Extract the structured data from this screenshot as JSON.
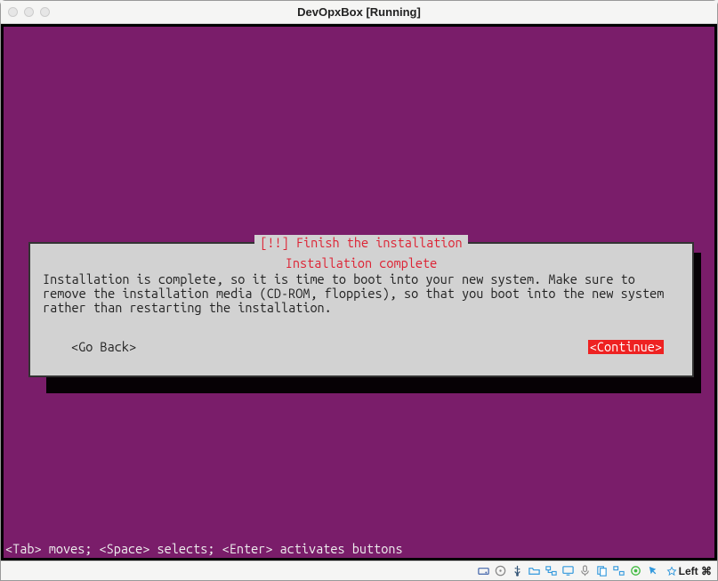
{
  "window": {
    "title_app": "DevOpxBox",
    "title_state": "[Running]"
  },
  "dialog": {
    "title": "[!!] Finish the installation",
    "subtitle": "Installation complete",
    "body": "Installation is complete, so it is time to boot into your new system. Make sure to remove the installation media (CD-ROM, floppies), so that you boot into the new system rather than restarting the installation.",
    "go_back": "<Go Back>",
    "continue": "<Continue>"
  },
  "hint": "<Tab> moves; <Space> selects; <Enter> activates buttons",
  "statusbar": {
    "hostkey_label": "Left ⌘"
  }
}
